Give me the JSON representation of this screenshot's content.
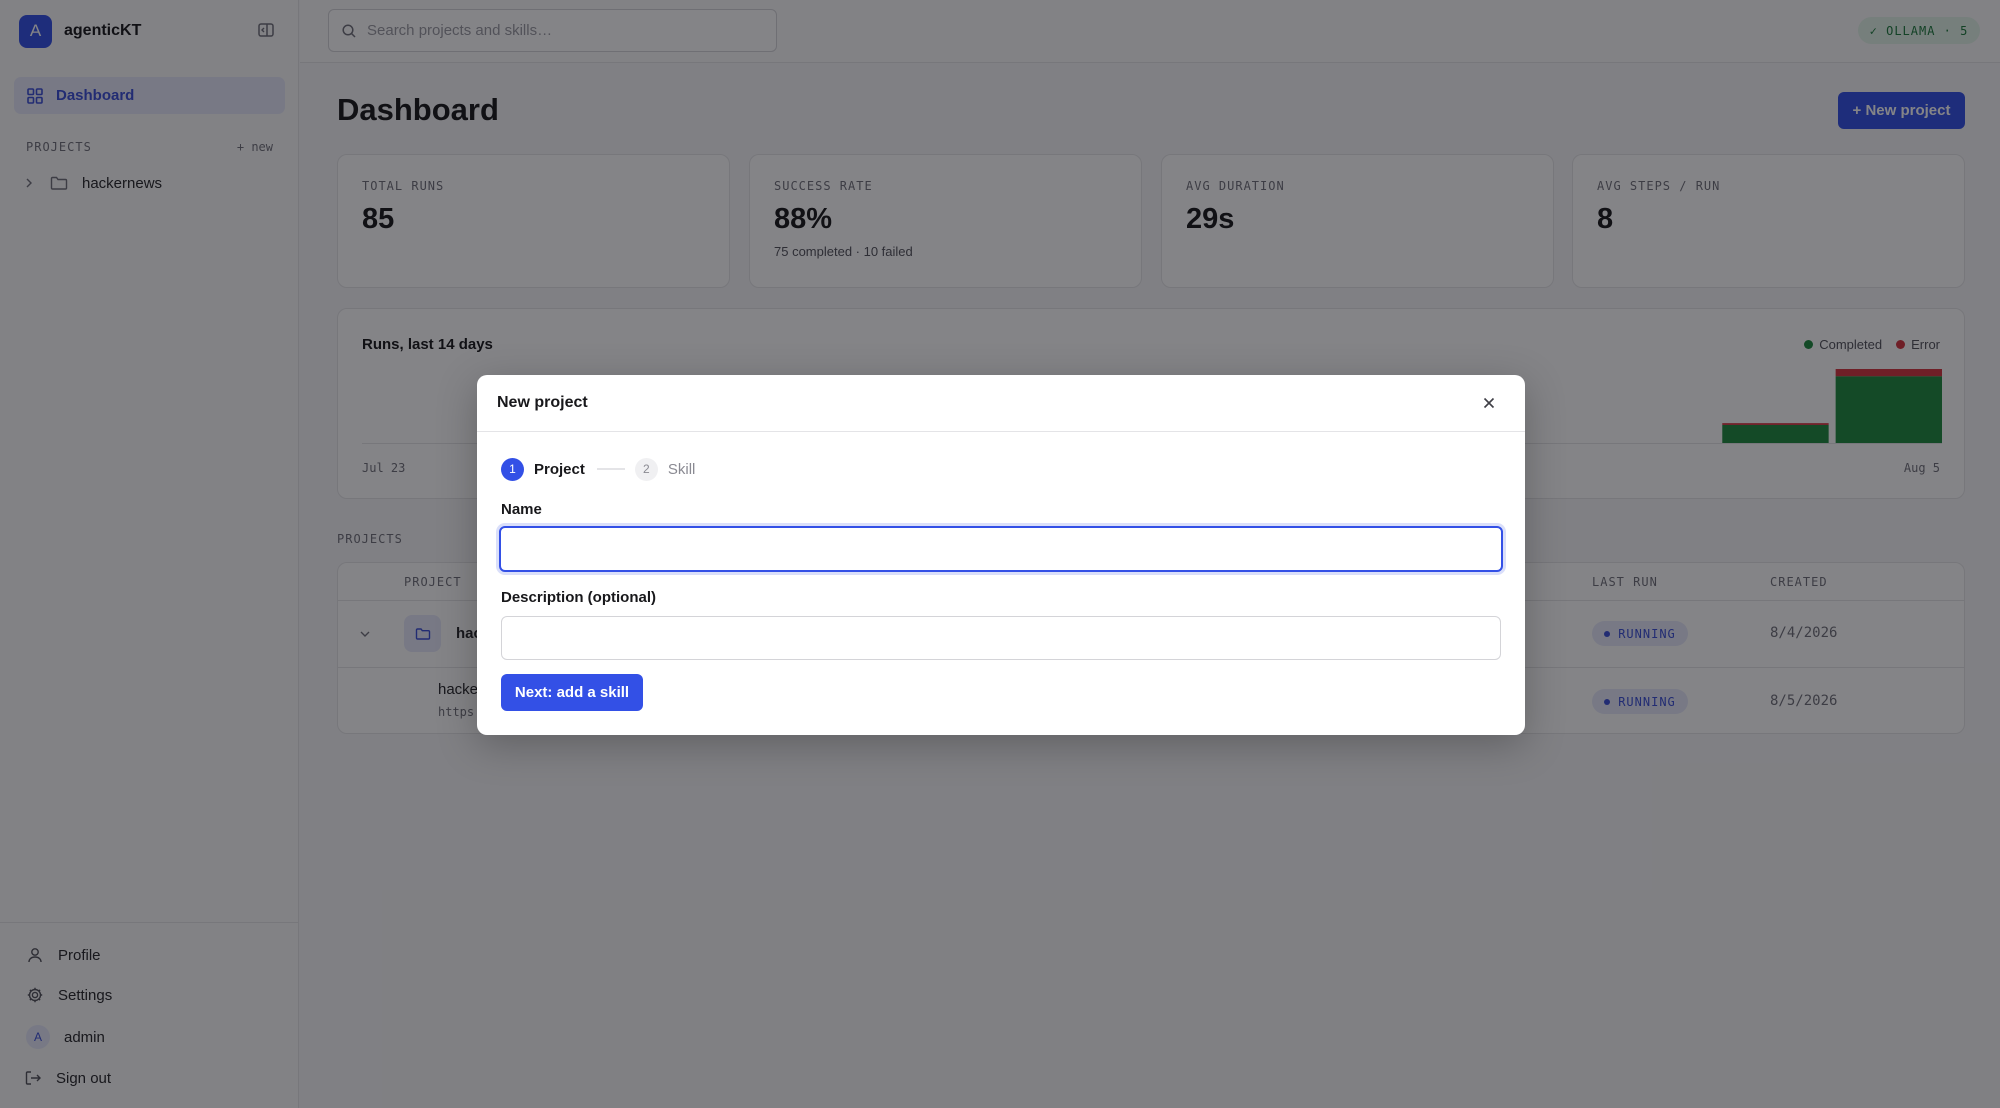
{
  "app": {
    "name": "agenticKT",
    "avatar_letter": "A"
  },
  "sidebar": {
    "nav": [
      {
        "label": "Dashboard",
        "active": true
      }
    ],
    "projects_heading": "PROJECTS",
    "projects_new": "+ new",
    "projects": [
      {
        "label": "hackernews"
      }
    ],
    "bottom": {
      "profile": "Profile",
      "settings": "Settings",
      "user_avatar": "A",
      "user_name": "admin",
      "sign_out": "Sign out"
    }
  },
  "topbar": {
    "search_placeholder": "Search projects and skills…",
    "status_badge": "✓ OLLAMA · 5"
  },
  "main": {
    "title": "Dashboard",
    "new_project_button": "+ New project",
    "stats": [
      {
        "label": "TOTAL RUNS",
        "value": "85",
        "sub": ""
      },
      {
        "label": "SUCCESS RATE",
        "value": "88%",
        "sub": "75 completed · 10 failed"
      },
      {
        "label": "AVG DURATION",
        "value": "29s",
        "sub": ""
      },
      {
        "label": "AVG STEPS / RUN",
        "value": "8",
        "sub": ""
      }
    ],
    "projects_label": "PROJECTS",
    "table": {
      "headers": {
        "project": "PROJECT",
        "last_run": "LAST RUN",
        "created": "CREATED"
      },
      "rows": [
        {
          "name": "hac",
          "last_run": "RUNNING",
          "created": "8/4/2026"
        },
        {
          "name": "hacke",
          "sub": "https",
          "last_run": "RUNNING",
          "created": "8/5/2026"
        }
      ]
    }
  },
  "chart_data": {
    "type": "bar",
    "title": "Runs, last 14 days",
    "x_start_label": "Jul 23",
    "x_end_label": "Aug 5",
    "legend": [
      {
        "name": "Completed",
        "color": "#1f8a3e"
      },
      {
        "name": "Error",
        "color": "#d4343f"
      }
    ],
    "stacked": true,
    "legend_position": "top-right",
    "grid": false,
    "visible_bars": [
      {
        "slot": 12,
        "completed": 10,
        "error": 1
      },
      {
        "slot": 13,
        "completed": 37,
        "error": 4
      }
    ]
  },
  "modal": {
    "title": "New project",
    "steps": [
      {
        "num": "1",
        "label": "Project",
        "active": true
      },
      {
        "num": "2",
        "label": "Skill",
        "active": false
      }
    ],
    "name_label": "Name",
    "name_value": "",
    "description_label": "Description (optional)",
    "description_value": "",
    "next_button": "Next: add a skill"
  }
}
